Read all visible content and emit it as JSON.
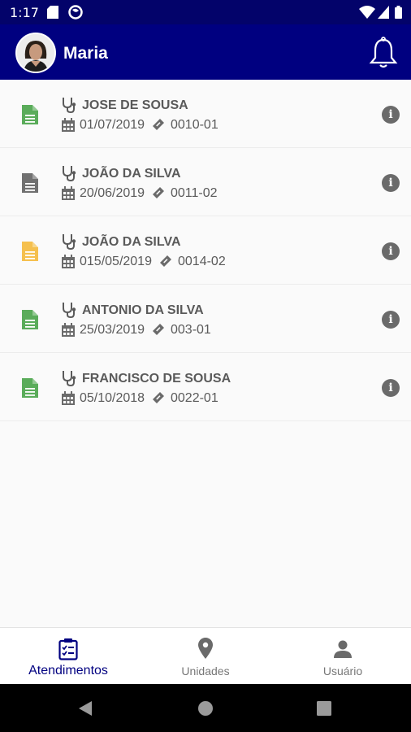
{
  "status_bar": {
    "time": "1:17"
  },
  "header": {
    "user_name": "Maria"
  },
  "appointments": [
    {
      "doctor": "JOSE DE SOUSA",
      "date": "01/07/2019",
      "code": "0010-01",
      "doc_color": "#5aac5a"
    },
    {
      "doctor": "JOÃO DA SILVA",
      "date": "20/06/2019",
      "code": "0011-02",
      "doc_color": "#707070"
    },
    {
      "doctor": "JOÃO DA SILVA",
      "date": "015/05/2019",
      "code": "0014-02",
      "doc_color": "#f5c04e"
    },
    {
      "doctor": "ANTONIO DA SILVA",
      "date": "25/03/2019",
      "code": "003-01",
      "doc_color": "#5aac5a"
    },
    {
      "doctor": "FRANCISCO DE SOUSA",
      "date": "05/10/2018",
      "code": "0022-01",
      "doc_color": "#5aac5a"
    }
  ],
  "bottom_nav": [
    {
      "label": "Atendimentos",
      "icon": "clipboard-icon",
      "active": true
    },
    {
      "label": "Unidades",
      "icon": "map-pin-icon",
      "active": false
    },
    {
      "label": "Usuário",
      "icon": "person-icon",
      "active": false
    }
  ],
  "colors": {
    "primary": "#000080",
    "status_bar": "#03036a",
    "text": "#5a5a5a"
  }
}
